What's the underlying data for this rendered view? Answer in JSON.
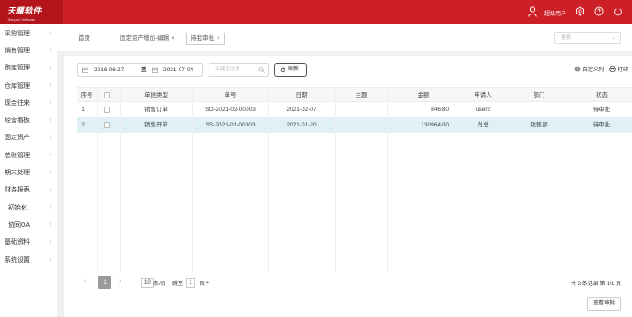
{
  "brand": {
    "name": "天耀软件",
    "sub": "Tianyao Software"
  },
  "header": {
    "user_name": "超级用户"
  },
  "sidebar": {
    "items": [
      {
        "label": "采购管理"
      },
      {
        "label": "销售管理"
      },
      {
        "label": "跑库管理"
      },
      {
        "label": "仓库管理"
      },
      {
        "label": "现金往来"
      },
      {
        "label": "经营看板"
      },
      {
        "label": "固定资产"
      },
      {
        "label": "总账管理"
      },
      {
        "label": "期末处理"
      },
      {
        "label": "财务报表"
      },
      {
        "label": "初始化"
      },
      {
        "label": "协同OA"
      },
      {
        "label": "基础资料"
      },
      {
        "label": "系统设置"
      }
    ]
  },
  "tabs": {
    "home": "首页",
    "fixed_asset": "固定资产增加-编辑",
    "pending": "待我审批",
    "close_symbol": "×",
    "search_placeholder": "搜索"
  },
  "filters": {
    "date_from": "2016-06-27",
    "date_sep": "至",
    "date_to": "2021-07-04",
    "keyword_placeholder": "关键字过滤",
    "refresh_label": "刷新",
    "custom_cols_label": "自定义列",
    "print_label": "打印"
  },
  "table": {
    "headers": [
      "序号",
      "",
      "单据类型",
      "单号",
      "日期",
      "主题",
      "金额",
      "申请人",
      "部门",
      "状态"
    ],
    "rows": [
      {
        "no": "1",
        "type": "销售订单",
        "code": "SO-2021-02-00003",
        "date": "2021-02-07",
        "subject": "",
        "amount": "846.80",
        "applicant": "user2",
        "dept": "",
        "status": "待审批"
      },
      {
        "no": "2",
        "type": "销售开单",
        "code": "SS-2021-01-00003",
        "date": "2021-01-20",
        "subject": "",
        "amount": "130964.00",
        "applicant": "肖总",
        "dept": "销售部",
        "status": "待审批"
      }
    ]
  },
  "pager": {
    "prev": "‹",
    "current": "1",
    "next": "›",
    "page_size": "10",
    "page_size_unit": "条/页",
    "jump_label": "跳至",
    "jump_value": "1",
    "jump_unit": "页",
    "go": "↵",
    "total": "共 2 条记录    第 1/1 页"
  },
  "actions": {
    "audit_label": "查看审批"
  },
  "colors": {
    "brand_red": "#cc1f26",
    "logo_red": "#b3141c",
    "row_highlight": "#dff0f7"
  }
}
